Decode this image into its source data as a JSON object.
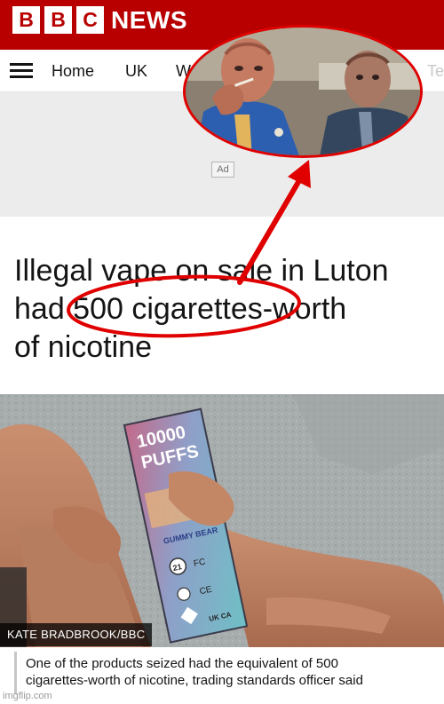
{
  "brand": {
    "blocks": [
      "B",
      "B",
      "C"
    ],
    "word": "NEWS",
    "bar_color": "#b80000"
  },
  "nav": {
    "menu_icon": "hamburger-menu-icon",
    "items": [
      "Home",
      "UK",
      "W"
    ],
    "faded_item": "Te"
  },
  "ad": {
    "label": "Ad"
  },
  "article": {
    "headline_line1": "Illegal vape on sale in Luton",
    "headline_line2": "had 500 cigarettes-worth",
    "headline_line3": "of nicotine",
    "photo_credit": "KATE BRADBROOK/BBC",
    "caption_line1": "One of the products seized had the equivalent of 500",
    "caption_line2": "cigarettes-worth of nicotine, trading standards officer said"
  },
  "product": {
    "line1": "10000",
    "line2": "PUFFS",
    "flavour": "GUMMY BEAR",
    "age": "21",
    "marks": [
      "FC",
      "CE",
      "UK CA"
    ]
  },
  "annotation": {
    "color": "#e00000"
  },
  "watermark": "imgflip.com"
}
